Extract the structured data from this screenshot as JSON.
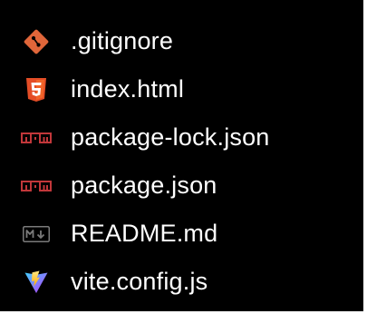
{
  "explorer": {
    "files": [
      {
        "name": ".gitignore",
        "icon": "git-icon",
        "icon_color": "#e0663a"
      },
      {
        "name": "index.html",
        "icon": "html5-icon",
        "icon_color": "#e44d26"
      },
      {
        "name": "package-lock.json",
        "icon": "npm-icon",
        "icon_color": "#c1373a"
      },
      {
        "name": "package.json",
        "icon": "npm-icon",
        "icon_color": "#c1373a"
      },
      {
        "name": "README.md",
        "icon": "markdown-icon",
        "icon_color": "#7a7a7a"
      },
      {
        "name": "vite.config.js",
        "icon": "vite-icon",
        "icon_color": "#a259ff"
      }
    ]
  }
}
